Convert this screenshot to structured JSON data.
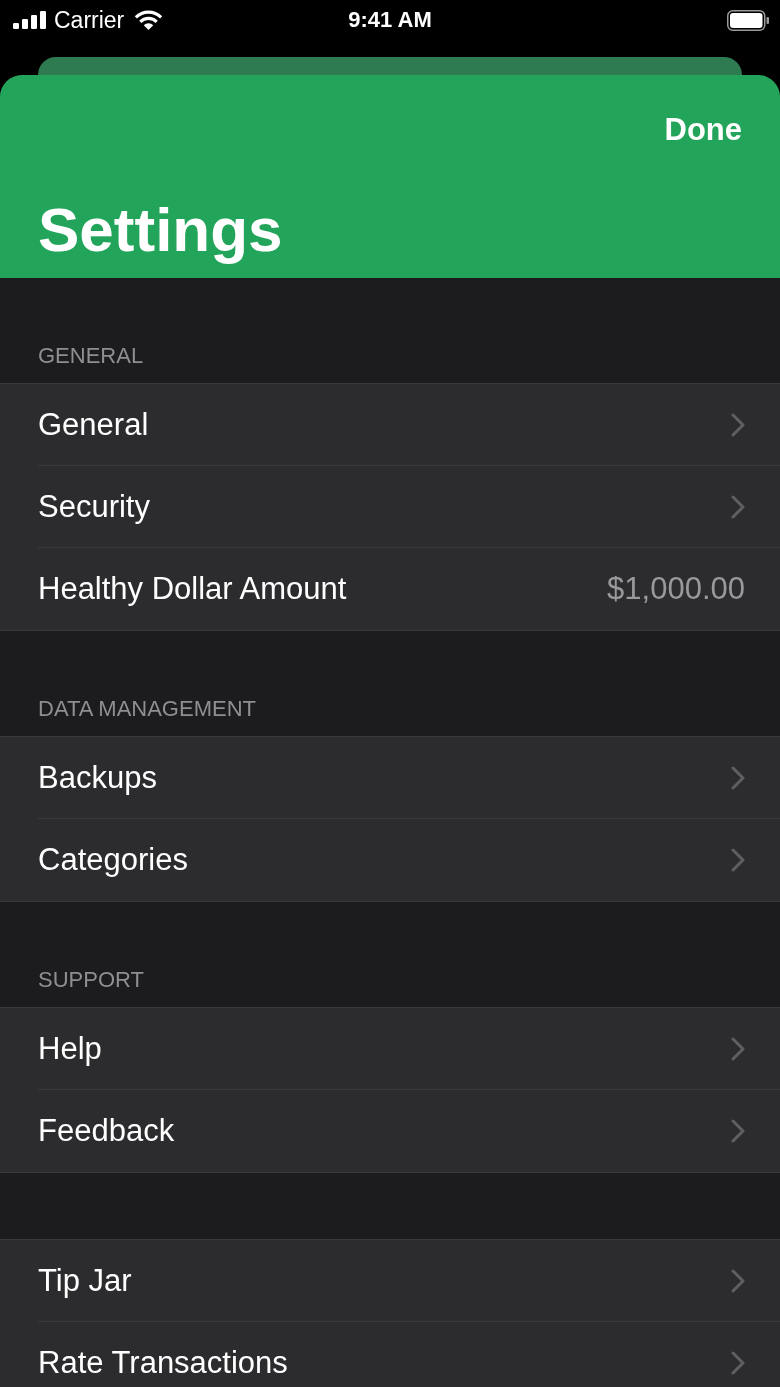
{
  "status_bar": {
    "carrier": "Carrier",
    "time": "9:41 AM"
  },
  "header": {
    "done_button": "Done",
    "title": "Settings"
  },
  "sections": [
    {
      "header": "GENERAL",
      "rows": [
        {
          "label": "General",
          "kind": "link"
        },
        {
          "label": "Security",
          "kind": "link"
        },
        {
          "label": "Healthy Dollar Amount",
          "kind": "value",
          "value": "$1,000.00"
        }
      ]
    },
    {
      "header": "DATA MANAGEMENT",
      "rows": [
        {
          "label": "Backups",
          "kind": "link"
        },
        {
          "label": "Categories",
          "kind": "link"
        }
      ]
    },
    {
      "header": "SUPPORT",
      "rows": [
        {
          "label": "Help",
          "kind": "link"
        },
        {
          "label": "Feedback",
          "kind": "link"
        }
      ]
    },
    {
      "rows": [
        {
          "label": "Tip Jar",
          "kind": "link"
        },
        {
          "label": "Rate Transactions",
          "kind": "link"
        }
      ]
    }
  ]
}
